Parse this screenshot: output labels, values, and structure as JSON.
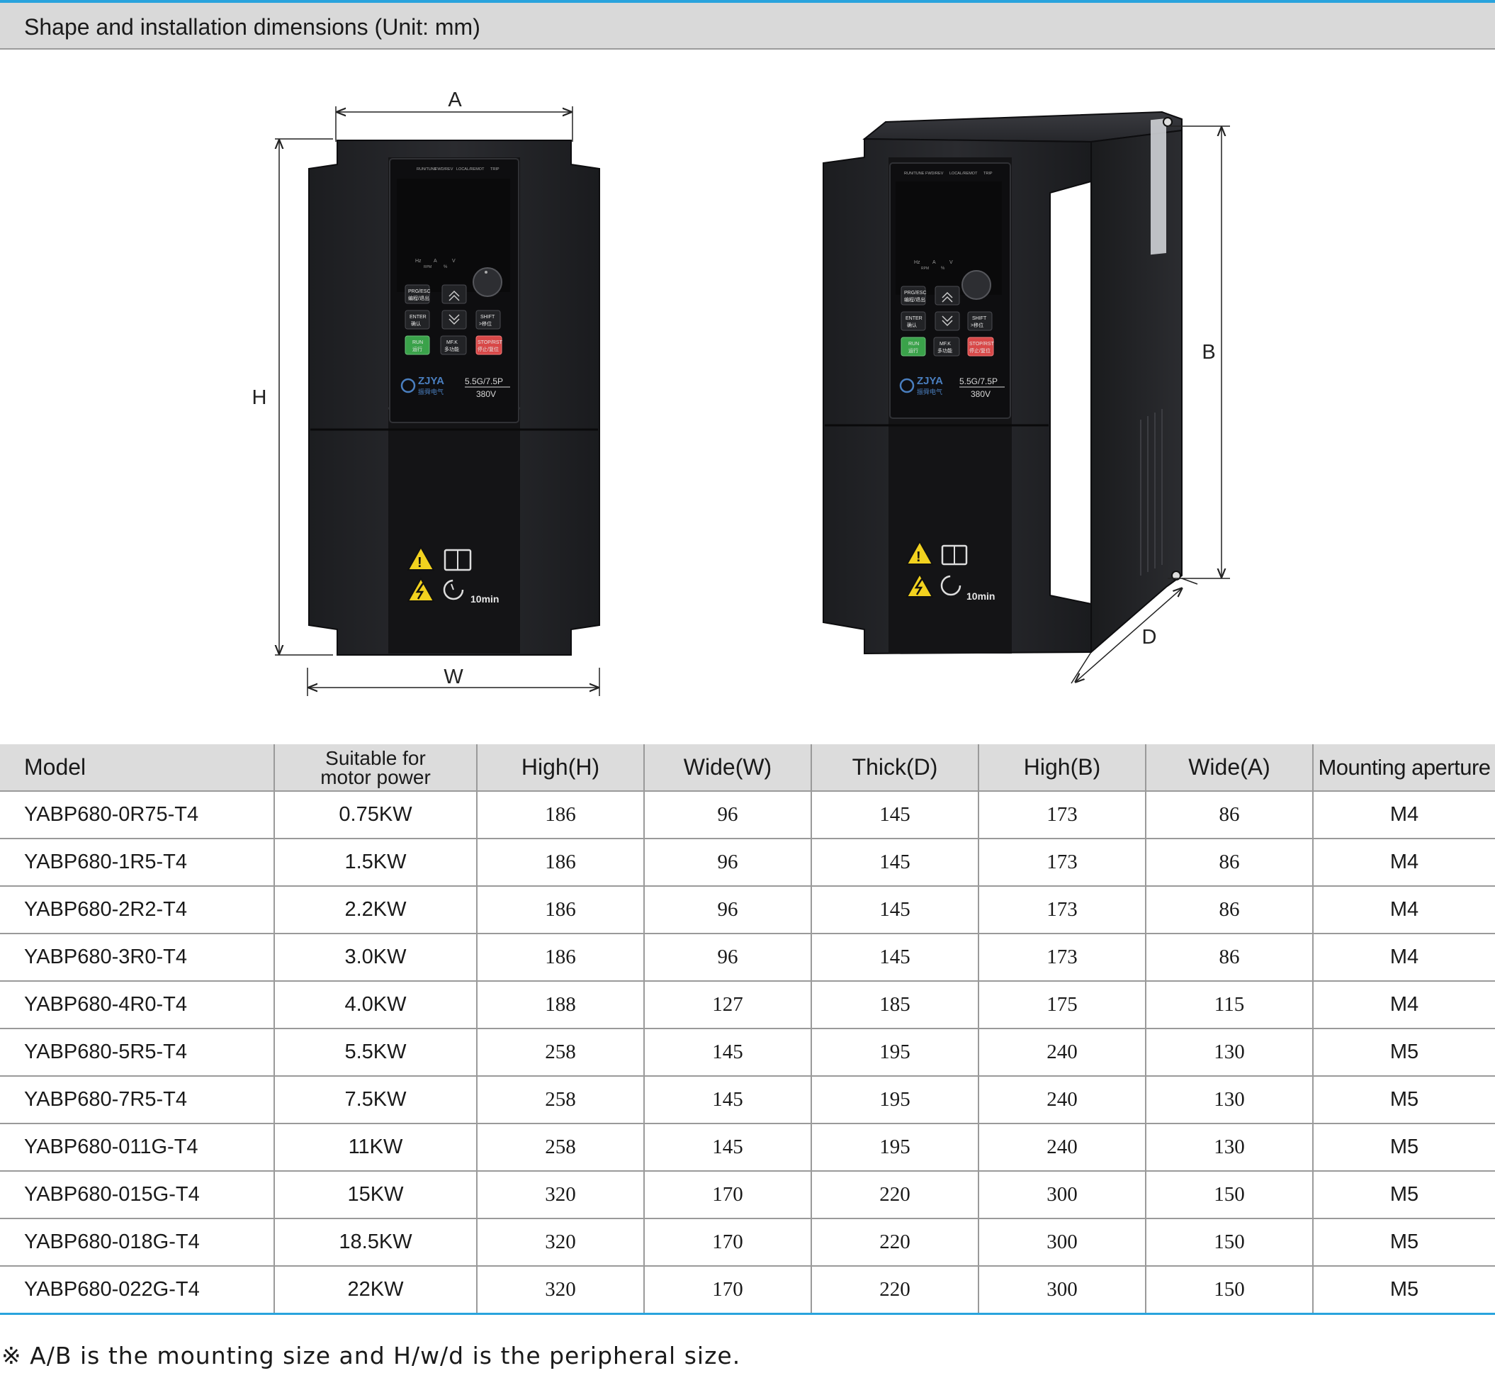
{
  "header": {
    "title": "Shape and installation dimensions (Unit: mm)"
  },
  "figure": {
    "front_labels": {
      "a": "A",
      "h": "H",
      "w": "W"
    },
    "side_labels": {
      "b": "B",
      "d": "D"
    },
    "panel": {
      "indicators": [
        "RUN/TUNE",
        "FWD/REV",
        "LOCAL/REMOT",
        "TRIP"
      ],
      "units": [
        "Hz",
        "A",
        "V",
        "RPM",
        "%"
      ],
      "keys": {
        "prg": "PRG/ESC",
        "prg_cn": "编程/退出",
        "enter": "ENTER",
        "enter_cn": "确认",
        "shift": "SHIFT",
        "shift_cn": ">移位",
        "run": "RUN",
        "run_cn": "运行",
        "mk": "MF.K",
        "mk_cn": "多功能",
        "stop": "STOP/RST",
        "stop_cn": "停止/复位"
      },
      "brand": "ZJYA",
      "brand_cn": "振舜电气",
      "rating": "5.5G/7.5P",
      "voltage": "380V",
      "discharge_time": "10min"
    }
  },
  "table": {
    "headers": {
      "model": "Model",
      "power_line1": "Suitable for",
      "power_line2": "motor power",
      "high_h": "High(H)",
      "wide_w": "Wide(W)",
      "thick_d": "Thick(D)",
      "high_b": "High(B)",
      "wide_a": "Wide(A)",
      "aperture": "Mounting aperture"
    },
    "rows": [
      {
        "model": "YABP680-0R75-T4",
        "power": "0.75KW",
        "h": "186",
        "w": "96",
        "d": "145",
        "b": "173",
        "a": "86",
        "aperture": "M4"
      },
      {
        "model": "YABP680-1R5-T4",
        "power": "1.5KW",
        "h": "186",
        "w": "96",
        "d": "145",
        "b": "173",
        "a": "86",
        "aperture": "M4"
      },
      {
        "model": "YABP680-2R2-T4",
        "power": "2.2KW",
        "h": "186",
        "w": "96",
        "d": "145",
        "b": "173",
        "a": "86",
        "aperture": "M4"
      },
      {
        "model": "YABP680-3R0-T4",
        "power": "3.0KW",
        "h": "186",
        "w": "96",
        "d": "145",
        "b": "173",
        "a": "86",
        "aperture": "M4"
      },
      {
        "model": "YABP680-4R0-T4",
        "power": "4.0KW",
        "h": "188",
        "w": "127",
        "d": "185",
        "b": "175",
        "a": "115",
        "aperture": "M4"
      },
      {
        "model": "YABP680-5R5-T4",
        "power": "5.5KW",
        "h": "258",
        "w": "145",
        "d": "195",
        "b": "240",
        "a": "130",
        "aperture": "M5"
      },
      {
        "model": "YABP680-7R5-T4",
        "power": "7.5KW",
        "h": "258",
        "w": "145",
        "d": "195",
        "b": "240",
        "a": "130",
        "aperture": "M5"
      },
      {
        "model": "YABP680-011G-T4",
        "power": "11KW",
        "h": "258",
        "w": "145",
        "d": "195",
        "b": "240",
        "a": "130",
        "aperture": "M5"
      },
      {
        "model": "YABP680-015G-T4",
        "power": "15KW",
        "h": "320",
        "w": "170",
        "d": "220",
        "b": "300",
        "a": "150",
        "aperture": "M5"
      },
      {
        "model": "YABP680-018G-T4",
        "power": "18.5KW",
        "h": "320",
        "w": "170",
        "d": "220",
        "b": "300",
        "a": "150",
        "aperture": "M5"
      },
      {
        "model": "YABP680-022G-T4",
        "power": "22KW",
        "h": "320",
        "w": "170",
        "d": "220",
        "b": "300",
        "a": "150",
        "aperture": "M5"
      }
    ]
  },
  "footnote": "※ A/B is the mounting size and H/w/d is the peripheral size."
}
